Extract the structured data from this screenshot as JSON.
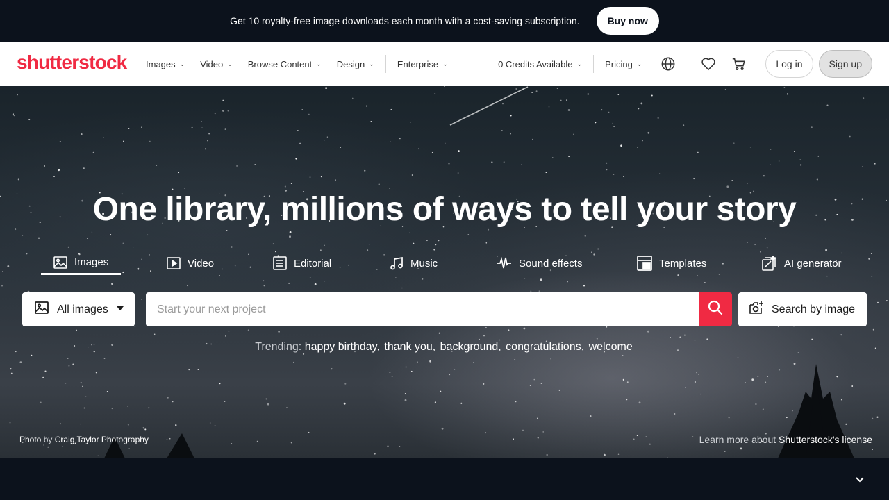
{
  "promo": {
    "text": "Get 10 royalty-free image downloads each month with a cost-saving subscription.",
    "button": "Buy now"
  },
  "header": {
    "logo": "shutterstock",
    "nav": [
      {
        "label": "Images"
      },
      {
        "label": "Video"
      },
      {
        "label": "Browse Content"
      },
      {
        "label": "Design"
      },
      {
        "label": "Enterprise"
      }
    ],
    "credits": "0 Credits Available",
    "pricing": "Pricing",
    "login": "Log in",
    "signup": "Sign up"
  },
  "hero": {
    "title": "One library, millions of ways to tell your story",
    "tabs": [
      {
        "label": "Images",
        "icon": "image-icon",
        "active": true
      },
      {
        "label": "Video",
        "icon": "video-play-icon"
      },
      {
        "label": "Editorial",
        "icon": "newspaper-icon"
      },
      {
        "label": "Music",
        "icon": "music-note-icon"
      },
      {
        "label": "Sound effects",
        "icon": "waveform-icon"
      },
      {
        "label": "Templates",
        "icon": "template-icon"
      },
      {
        "label": "AI generator",
        "icon": "ai-generator-icon"
      }
    ],
    "search": {
      "type_select": "All images",
      "placeholder": "Start your next project",
      "image_search": "Search by image"
    },
    "trending": {
      "label": "Trending:",
      "terms": [
        "happy birthday,",
        "thank you,",
        "background,",
        "congratulations,",
        "welcome"
      ]
    },
    "photo_credit": {
      "prefix": "Photo",
      "by": "by",
      "author": "Craig Taylor Photography"
    },
    "license": {
      "prefix": "Learn more about",
      "link": "Shutterstock's license"
    }
  },
  "colors": {
    "brand": "#f02a43",
    "dark": "#0c121c"
  }
}
